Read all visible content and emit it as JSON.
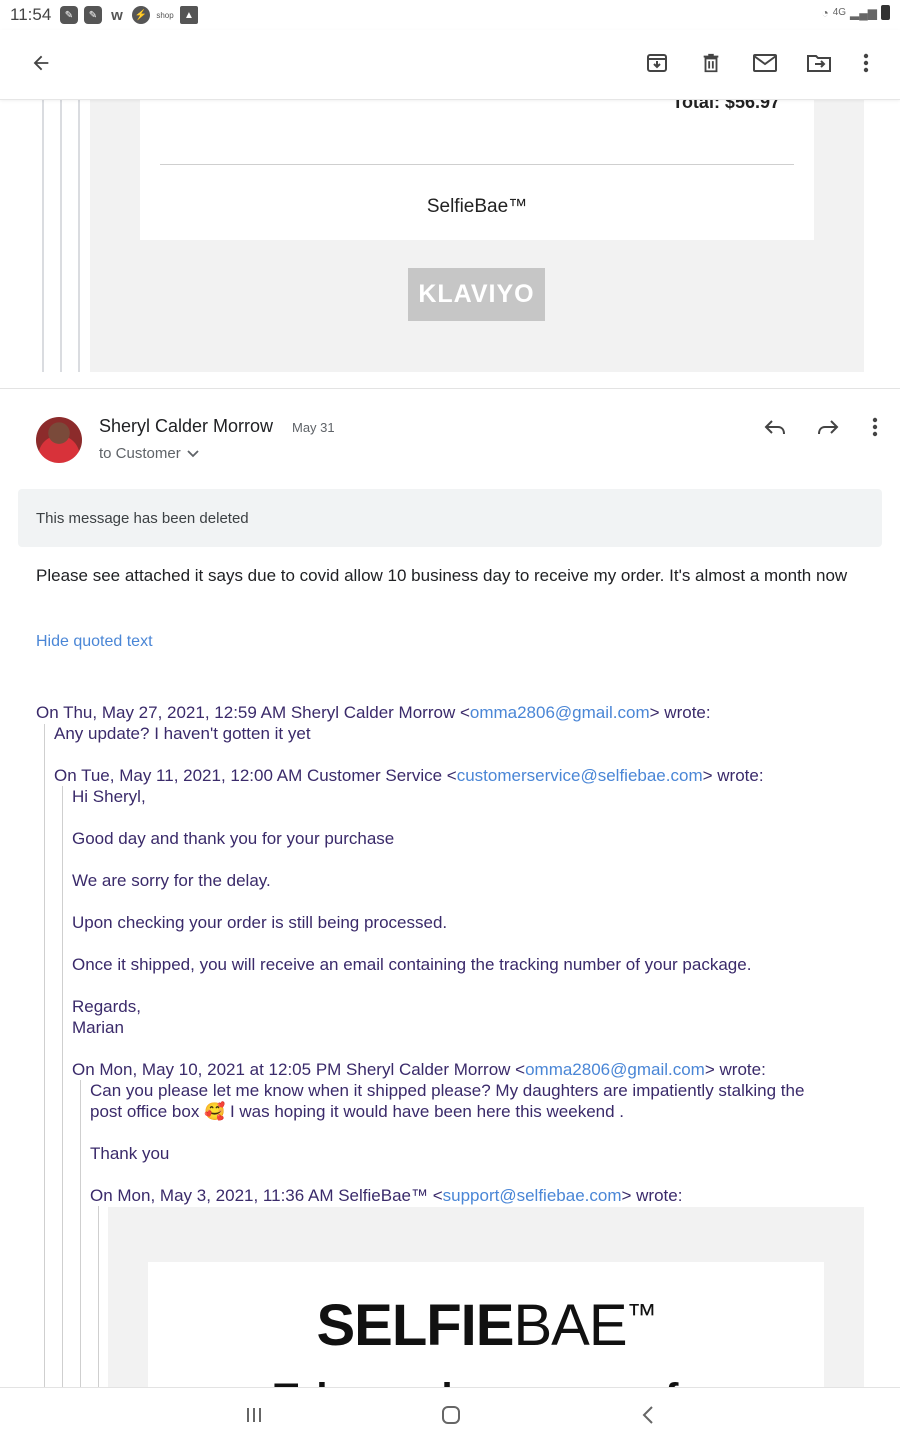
{
  "status_bar": {
    "time": "11:54",
    "notif_icons": [
      "app-icon",
      "app-icon",
      "w",
      "messenger-icon",
      "shop",
      "image-icon"
    ],
    "network": "4G"
  },
  "toolbar": {
    "back": "arrow-left-icon",
    "archive": "archive-icon",
    "delete": "trash-icon",
    "mark_unread": "mail-icon",
    "move": "move-to-icon",
    "more": "more-vert-icon"
  },
  "top_card": {
    "total_text": "Total: $56.97",
    "brand_text": "SelfieBae™",
    "klaviyo_label": "KLAVIYO"
  },
  "message": {
    "sender": "Sheryl Calder Morrow",
    "date": "May 31",
    "to": "to Customer",
    "deleted_notice": "This message has been deleted",
    "body": "Please see attached it says due to covid allow 10 business day to receive my order. It's almost a month now",
    "hide_quoted": "Hide quoted text"
  },
  "quoted": {
    "q1_header_pre": "On Thu, May 27, 2021, 12:59 AM Sheryl Calder Morrow <",
    "q1_email": "omma2806@gmail.com",
    "q1_header_post": "> wrote:",
    "q1_body": "Any update? I haven't gotten it yet",
    "q2_header_pre": "On Tue, May 11, 2021, 12:00 AM Customer Service <",
    "q2_email": "customerservice@selfiebae.com",
    "q2_header_post": "> wrote:",
    "q2_lines": [
      "Hi Sheryl,",
      "Good day and thank you for your purchase",
      "We are sorry for the delay.",
      "Upon checking your order is still being processed.",
      "Once it shipped, you will receive an email containing the tracking number of your package.",
      "Regards,",
      "Marian"
    ],
    "q3_header_pre": "On Mon, May 10, 2021 at 12:05 PM Sheryl Calder Morrow <",
    "q3_email": "omma2806@gmail.com",
    "q3_header_post": "> wrote:",
    "q3_line1": "Can you please let me know when it shipped please? My daughters are impatiently stalking the",
    "q3_line2_pre": "post office box ",
    "q3_emoji": "🥰",
    "q3_line2_post": " I was hoping it would have been here this weekend .",
    "q3_thanks": "Thank you",
    "q4_header_pre": "On Mon, May 3, 2021, 11:36 AM SelfieBae™ <",
    "q4_email": "support@selfiebae.com",
    "q4_header_post": "> wrote:"
  },
  "embedded": {
    "logo_bold": "SELFIE",
    "logo_light": "BAE",
    "logo_tm": "™",
    "cut_text": "Thank you for your order!"
  },
  "navbar": {
    "recents": "recents-icon",
    "home": "home-icon",
    "back": "back-icon"
  }
}
